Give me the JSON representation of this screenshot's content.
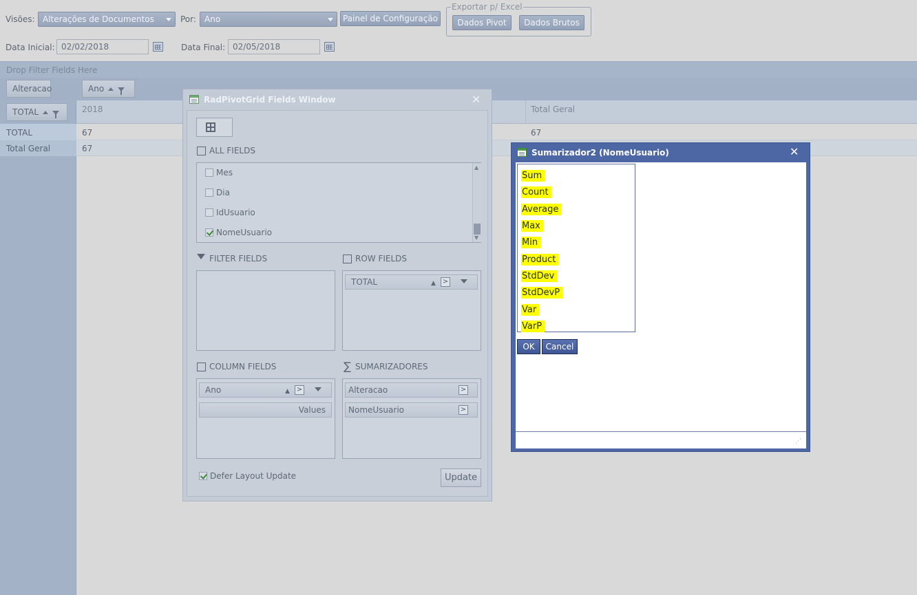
{
  "toolbar": {
    "visoes_label": "Visões:",
    "visoes_value": "Alterações de Documentos",
    "por_label": "Por:",
    "por_value": "Ano",
    "config_button": "Painel de Configuração",
    "export_legend": "Exportar p/ Excel",
    "export_pivot": "Dados Pivot",
    "export_raw": "Dados Brutos",
    "data_inicial_label": "Data Inicial:",
    "data_inicial_value": "02/02/2018",
    "data_final_label": "Data Final:",
    "data_final_value": "02/05/2018"
  },
  "pivot": {
    "filter_zone": "Drop Filter Fields Here",
    "data_field": "Alteracao",
    "column_field": "Ano",
    "row_field": "TOTAL",
    "col_header_2018": "2018",
    "col_header_total": "Total Geral",
    "rows": [
      {
        "label": "TOTAL",
        "v2018": "67",
        "total": "67"
      },
      {
        "label": "Total Geral",
        "v2018": "67",
        "total": ""
      }
    ]
  },
  "fields_window": {
    "title": "RadPivotGrid Fields Window",
    "all_fields_title": "ALL FIELDS",
    "all_fields": [
      {
        "label": "Mes",
        "checked": false
      },
      {
        "label": "Dia",
        "checked": false
      },
      {
        "label": "IdUsuario",
        "checked": false
      },
      {
        "label": "NomeUsuario",
        "checked": true
      }
    ],
    "filter_fields_title": "FILTER FIELDS",
    "row_fields_title": "ROW FIELDS",
    "row_fields": [
      "TOTAL"
    ],
    "column_fields_title": "COLUMN FIELDS",
    "column_fields": [
      "Ano",
      "Values"
    ],
    "sumarizadores_title": "SUMARIZADORES",
    "sumarizadores": [
      "Alteracao",
      "NomeUsuario"
    ],
    "defer_label": "Defer Layout Update",
    "update_button": "Update"
  },
  "summarizer_dialog": {
    "title": "Sumarizador2 (NomeUsuario)",
    "options": [
      "Sum",
      "Count",
      "Average",
      "Max",
      "Min",
      "Product",
      "StdDev",
      "StdDevP",
      "Var",
      "VarP"
    ],
    "ok": "OK",
    "cancel": "Cancel",
    "highlight_color": "#ffff00",
    "accent_color": "#4c67a4"
  }
}
